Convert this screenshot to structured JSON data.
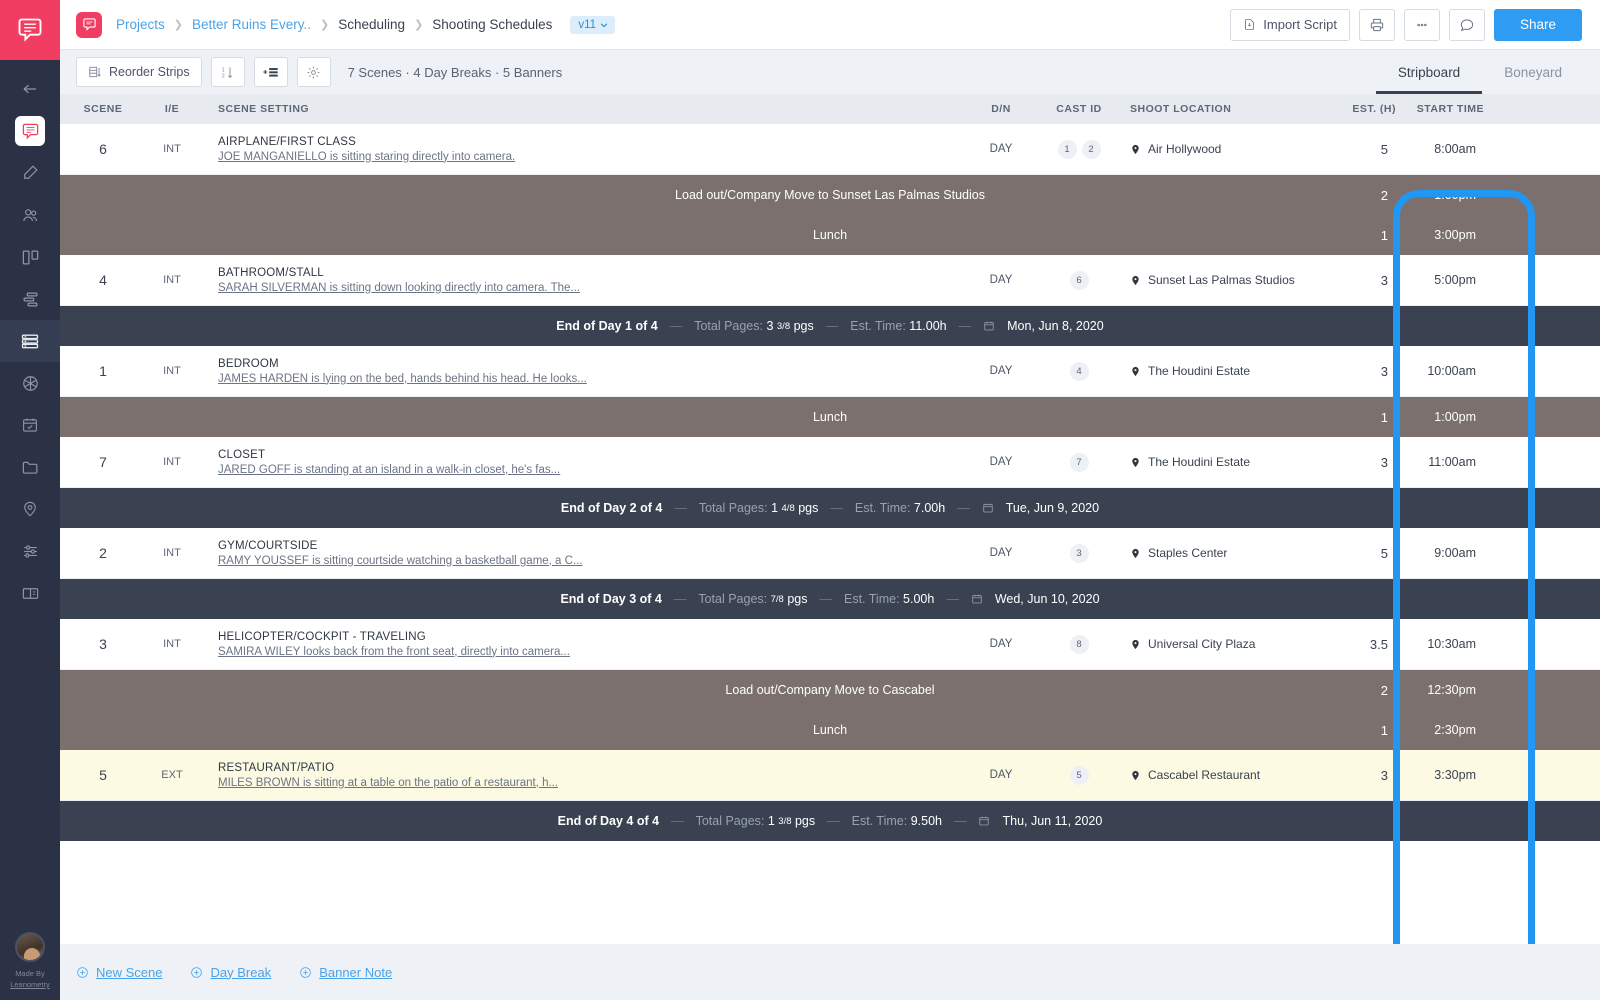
{
  "rail": {
    "logo_icon": "speech-script-logo",
    "items": [
      {
        "icon": "back-arrow-icon",
        "name": "collapse"
      },
      {
        "icon": "script-icon",
        "name": "script",
        "state": "chip"
      },
      {
        "icon": "pencil-icon",
        "name": "write"
      },
      {
        "icon": "people-icon",
        "name": "cast"
      },
      {
        "icon": "board-columns-icon",
        "name": "breakdown"
      },
      {
        "icon": "gantt-icon",
        "name": "shotlist"
      },
      {
        "icon": "stripboard-icon",
        "name": "scheduling",
        "state": "active"
      },
      {
        "icon": "aperture-icon",
        "name": "camera"
      },
      {
        "icon": "calendar-check-icon",
        "name": "calendar"
      },
      {
        "icon": "folder-icon",
        "name": "files"
      },
      {
        "icon": "location-pin-icon",
        "name": "locations"
      },
      {
        "icon": "sliders-icon",
        "name": "settings"
      },
      {
        "icon": "book-icon",
        "name": "reports"
      }
    ],
    "made_by_line1": "Made By",
    "made_by_line2": "Leanometry"
  },
  "topbar": {
    "project_badge_icon": "script-logo-icon",
    "breadcrumb": [
      {
        "label": "Projects",
        "link": true
      },
      {
        "label": "Better Ruins Every..",
        "link": true
      },
      {
        "label": "Scheduling",
        "link": false
      },
      {
        "label": "Shooting Schedules",
        "link": false
      }
    ],
    "version_label": "v11",
    "version_caret_icon": "chevron-down-icon",
    "import_script_label": "Import Script",
    "import_icon": "file-import-icon",
    "print_icon": "printer-icon",
    "more_icon": "ellipsis-icon",
    "comment_icon": "comment-icon",
    "share_label": "Share"
  },
  "subbar": {
    "reorder_label": "Reorder Strips",
    "reorder_icon": "reorder-icon",
    "sort_icon": "sort-numeric-icon",
    "add_strip_icon": "add-strip-icon",
    "gear_icon": "gear-icon",
    "meta": "7 Scenes · 4 Day Breaks · 5 Banners",
    "tabs": [
      {
        "label": "Stripboard",
        "active": true
      },
      {
        "label": "Boneyard",
        "active": false
      }
    ]
  },
  "table": {
    "headers": {
      "scene": "SCENE",
      "ie": "I/E",
      "setting": "SCENE SETTING",
      "dn": "D/N",
      "cast": "CAST ID",
      "location": "SHOOT LOCATION",
      "est": "EST. (H)",
      "start": "START TIME"
    },
    "rows": [
      {
        "kind": "scene",
        "scene": "6",
        "ie": "INT",
        "title": "AIRPLANE/FIRST CLASS",
        "desc": "JOE MANGANIELLO is sitting staring directly into camera.",
        "dn": "DAY",
        "cast": [
          "1",
          "2"
        ],
        "location": "Air Hollywood",
        "location_icon": "location-pin-icon",
        "est": "5",
        "start": "8:00am",
        "highlight": false
      },
      {
        "kind": "banner",
        "text": "Load out/Company Move to Sunset Las Palmas Studios",
        "est": "2",
        "start": "1:00pm"
      },
      {
        "kind": "banner",
        "text": "Lunch",
        "est": "1",
        "start": "3:00pm"
      },
      {
        "kind": "scene",
        "scene": "4",
        "ie": "INT",
        "title": "BATHROOM/STALL",
        "desc": "SARAH SILVERMAN is sitting down looking directly into camera. The...",
        "dn": "DAY",
        "cast": [
          "6"
        ],
        "location": "Sunset Las Palmas Studios",
        "location_icon": "location-pin-icon",
        "est": "3",
        "start": "5:00pm",
        "highlight": false
      },
      {
        "kind": "day",
        "title": "End of Day 1 of 4",
        "pages_label": "Total Pages:",
        "pages_value": "3",
        "pages_frac": "3/8",
        "pages_unit": "pgs",
        "time_label": "Est. Time:",
        "time_value": "11.00h",
        "date_icon": "calendar-icon",
        "date": "Mon, Jun 8, 2020"
      },
      {
        "kind": "scene",
        "scene": "1",
        "ie": "INT",
        "title": "BEDROOM",
        "desc": "JAMES HARDEN is lying on the bed, hands behind his head. He looks...",
        "dn": "DAY",
        "cast": [
          "4"
        ],
        "location": "The Houdini Estate",
        "location_icon": "location-pin-icon",
        "est": "3",
        "start": "10:00am",
        "highlight": false
      },
      {
        "kind": "banner",
        "text": "Lunch",
        "est": "1",
        "start": "1:00pm"
      },
      {
        "kind": "scene",
        "scene": "7",
        "ie": "INT",
        "title": "CLOSET",
        "desc": "JARED GOFF is standing at an island in a walk-in closet, he's fas...",
        "dn": "DAY",
        "cast": [
          "7"
        ],
        "location": "The Houdini Estate",
        "location_icon": "location-pin-icon",
        "est": "3",
        "start": "11:00am",
        "highlight": false
      },
      {
        "kind": "day",
        "title": "End of Day 2 of 4",
        "pages_label": "Total Pages:",
        "pages_value": "1",
        "pages_frac": "4/8",
        "pages_unit": "pgs",
        "time_label": "Est. Time:",
        "time_value": "7.00h",
        "date_icon": "calendar-icon",
        "date": "Tue, Jun 9, 2020"
      },
      {
        "kind": "scene",
        "scene": "2",
        "ie": "INT",
        "title": "GYM/COURTSIDE",
        "desc": "RAMY YOUSSEF is sitting courtside watching a basketball game, a C...",
        "dn": "DAY",
        "cast": [
          "3"
        ],
        "location": "Staples Center",
        "location_icon": "location-pin-icon",
        "est": "5",
        "start": "9:00am",
        "highlight": false
      },
      {
        "kind": "day",
        "title": "End of Day 3 of 4",
        "pages_label": "Total Pages:",
        "pages_value": "",
        "pages_frac": "7/8",
        "pages_unit": "pgs",
        "time_label": "Est. Time:",
        "time_value": "5.00h",
        "date_icon": "calendar-icon",
        "date": "Wed, Jun 10, 2020"
      },
      {
        "kind": "scene",
        "scene": "3",
        "ie": "INT",
        "title": "HELICOPTER/COCKPIT - TRAVELING",
        "desc": "SAMIRA WILEY looks back from the front seat, directly into camera...",
        "dn": "DAY",
        "cast": [
          "8"
        ],
        "location": "Universal City Plaza",
        "location_icon": "location-pin-icon",
        "est": "3.5",
        "start": "10:30am",
        "highlight": false
      },
      {
        "kind": "banner",
        "text": "Load out/Company Move to Cascabel",
        "est": "2",
        "start": "12:30pm"
      },
      {
        "kind": "banner",
        "text": "Lunch",
        "est": "1",
        "start": "2:30pm"
      },
      {
        "kind": "scene",
        "scene": "5",
        "ie": "EXT",
        "title": "RESTAURANT/PATIO",
        "desc": "MILES BROWN is sitting at a table on the patio of a restaurant, h...",
        "dn": "DAY",
        "cast": [
          "5"
        ],
        "location": "Cascabel Restaurant",
        "location_icon": "location-pin-icon",
        "est": "3",
        "start": "3:30pm",
        "highlight": true
      },
      {
        "kind": "day",
        "title": "End of Day 4 of 4",
        "pages_label": "Total Pages:",
        "pages_value": "1",
        "pages_frac": "3/8",
        "pages_unit": "pgs",
        "time_label": "Est. Time:",
        "time_value": "9.50h",
        "date_icon": "calendar-icon",
        "date": "Thu, Jun 11, 2020"
      }
    ]
  },
  "actions": [
    {
      "icon": "plus-circle-icon",
      "label": "New Scene"
    },
    {
      "icon": "plus-circle-icon",
      "label": "Day Break"
    },
    {
      "icon": "plus-circle-icon",
      "label": "Banner Note"
    }
  ],
  "annotation": {
    "shape": "rounded-rect-highlight",
    "color": "#2196f3"
  }
}
